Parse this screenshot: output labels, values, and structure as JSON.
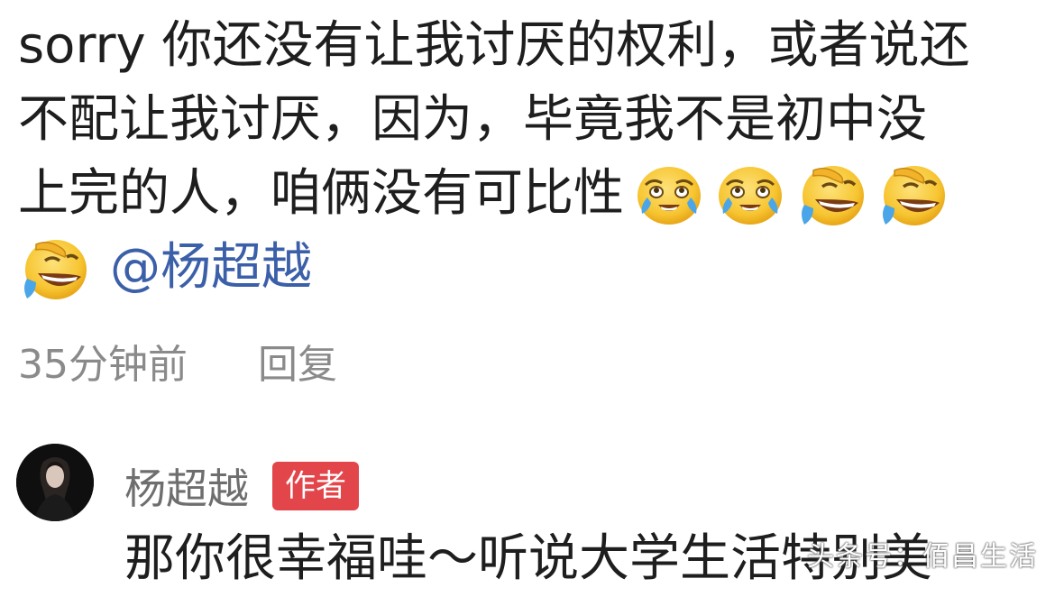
{
  "comment": {
    "line1": "sorry 你还没有让我讨厌的权利，或者说还",
    "line2": "不配让我讨厌，因为，毕竟我不是初中没",
    "line3": "上完的人，咱俩没有可比性",
    "emojis_line3": [
      "tears-of-joy-icon",
      "tears-of-joy-icon",
      "rolling-laugh-icon",
      "rolling-laugh-icon"
    ],
    "emojis_line4": [
      "rolling-laugh-icon"
    ],
    "mention": "@杨超越"
  },
  "meta": {
    "time": "35分钟前",
    "reply_label": "回复"
  },
  "reply": {
    "author_name": "杨超越",
    "author_badge": "作者",
    "text": "那你很幸福哇～听说大学生活特别美",
    "watermark": "头条号：佰昌生活"
  },
  "colors": {
    "text": "#1e1e1e",
    "meta": "#8a8a8a",
    "mention": "#3b5fa8",
    "badge": "#e2454a",
    "emoji_face": "#f7c531"
  }
}
